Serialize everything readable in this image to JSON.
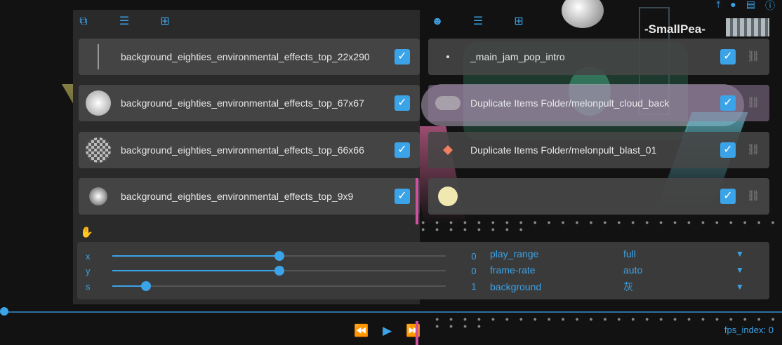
{
  "watermark": "-SmallPea-",
  "left_panel": {
    "rows": [
      {
        "label": "background_eighties_environmental_effects_top_22x290",
        "checked": true
      },
      {
        "label": "background_eighties_environmental_effects_top_67x67",
        "checked": true
      },
      {
        "label": "background_eighties_environmental_effects_top_66x66",
        "checked": true
      },
      {
        "label": "background_eighties_environmental_effects_top_9x9",
        "checked": true
      }
    ]
  },
  "right_panel": {
    "rows": [
      {
        "label": "_main_jam_pop_intro",
        "checked": true
      },
      {
        "label": "Duplicate Items Folder/melonpult_cloud_back",
        "checked": true
      },
      {
        "label": "Duplicate Items Folder/melonpult_blast_01",
        "checked": true
      },
      {
        "label": "",
        "checked": true
      }
    ]
  },
  "controls": {
    "sliders": [
      {
        "axis": "x",
        "value": "0",
        "fraction": 0.5
      },
      {
        "axis": "y",
        "value": "0",
        "fraction": 0.5
      },
      {
        "axis": "s",
        "value": "1",
        "fraction": 0.1
      }
    ],
    "options": [
      {
        "label": "play_range",
        "value": "full"
      },
      {
        "label": "frame-rate",
        "value": "auto"
      },
      {
        "label": "background",
        "value": "灰"
      }
    ]
  },
  "status": {
    "fps_label": "fps_index: 0"
  },
  "colors": {
    "accent": "#3ba3e8",
    "panel": "#2a2a2a",
    "row": "#464646",
    "marker": "#d04fa0"
  }
}
